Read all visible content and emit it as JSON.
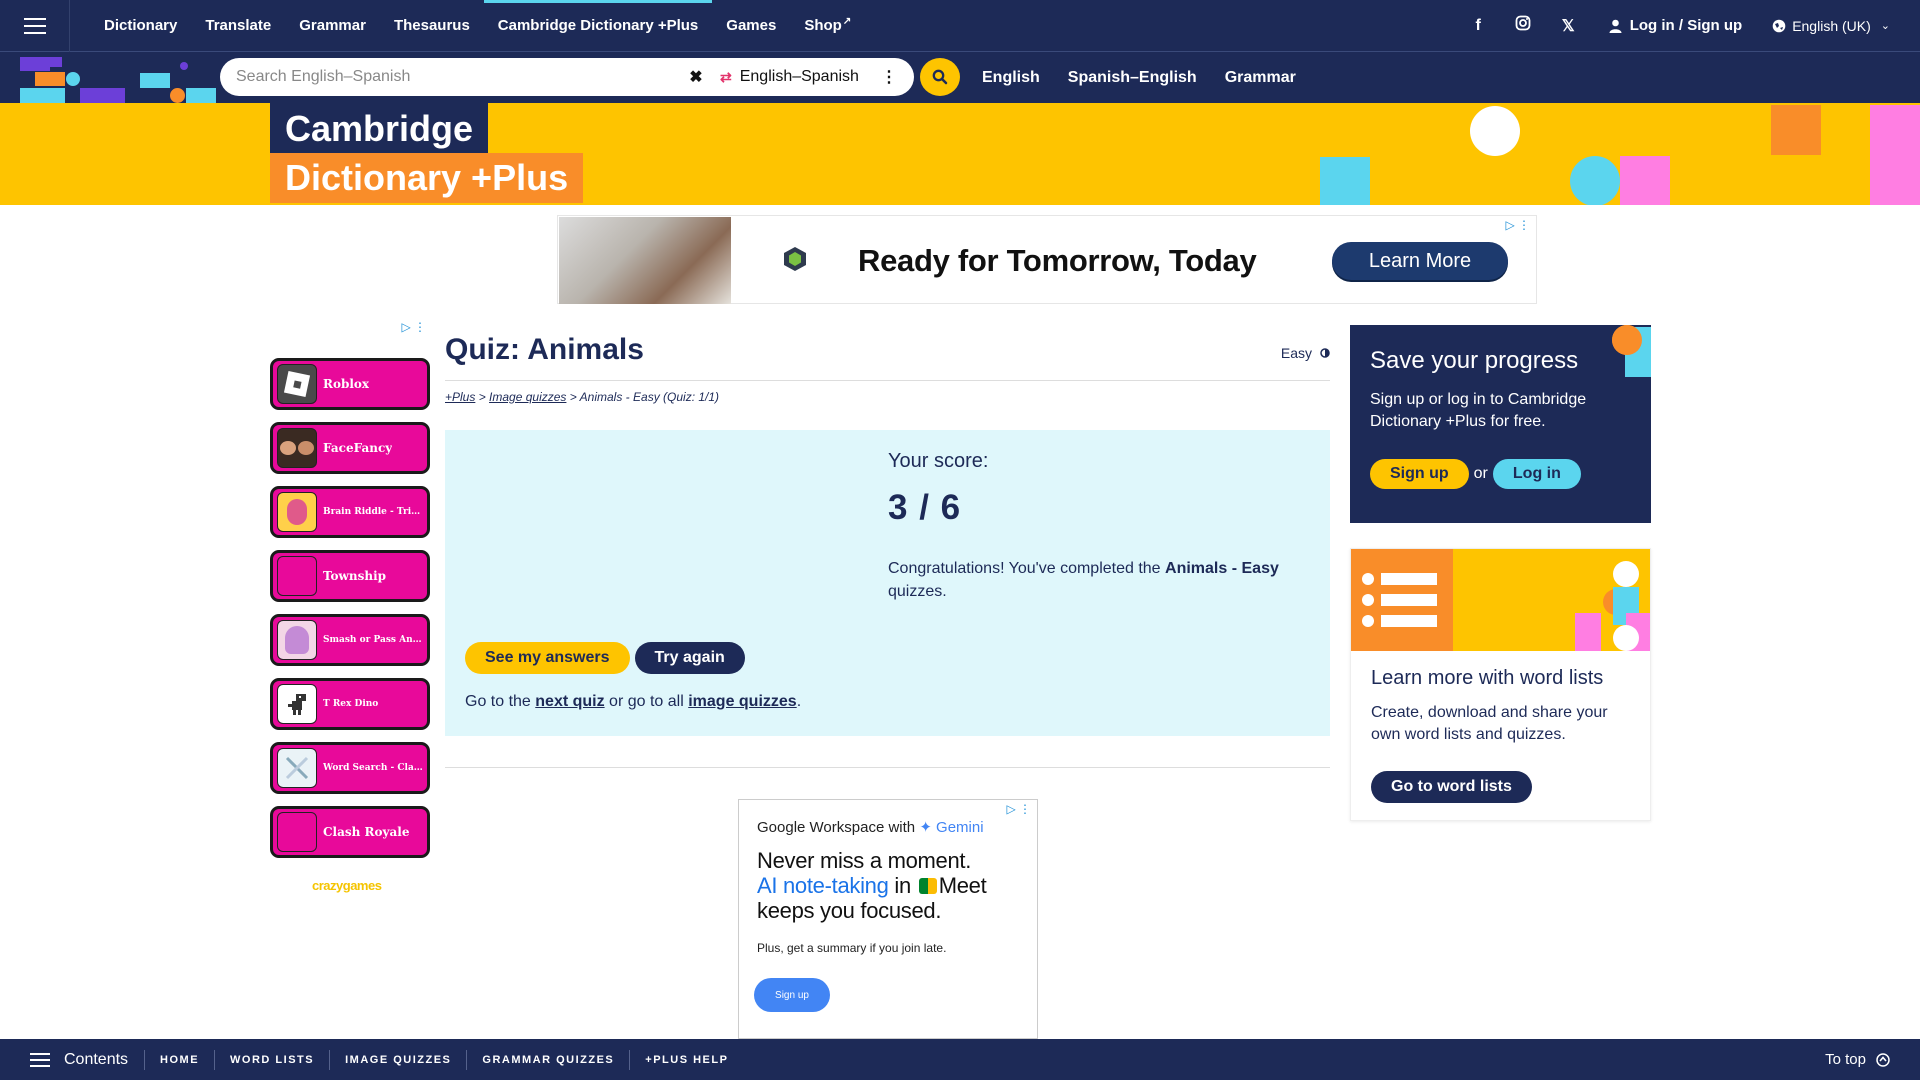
{
  "topnav": {
    "links": [
      "Dictionary",
      "Translate",
      "Grammar",
      "Thesaurus",
      "Cambridge Dictionary +Plus",
      "Games",
      "Shop"
    ],
    "active": "Cambridge Dictionary +Plus",
    "login_label": "Log in / Sign up",
    "language": "English (UK)",
    "social_icons": [
      "facebook-icon",
      "instagram-icon",
      "x-icon"
    ]
  },
  "search": {
    "placeholder": "Search English–Spanish",
    "dictionary": "English–Spanish",
    "sublinks": [
      "English",
      "Spanish–English",
      "Grammar"
    ]
  },
  "banner": {
    "line1": "Cambridge",
    "line2": "Dictionary +Plus"
  },
  "ad_top": {
    "headline": "Ready for Tomorrow, Today",
    "button": "Learn More"
  },
  "left_ad": {
    "games": [
      "Roblox",
      "FaceFancy",
      "Brain Riddle - Tric...",
      "Township",
      "Smash or Pass Ani...",
      "T Rex Dino",
      "Word Search - Clas...",
      "Clash Royale"
    ],
    "brand": "crazygames"
  },
  "quiz": {
    "title": "Quiz: Animals",
    "difficulty": "Easy",
    "breadcrumb": {
      "link1": "+Plus",
      "link2": "Image quizzes",
      "current": "Animals - Easy (Quiz: 1/1)"
    },
    "score_label": "Your score:",
    "score_value": "3 / 6",
    "congrats_prefix": "Congratulations! You've completed the ",
    "congrats_bold": "Animals - Easy",
    "congrats_suffix": " quizzes.",
    "see_answers": "See my answers",
    "try_again": "Try again",
    "goto_prefix": "Go to the ",
    "next_quiz": "next quiz",
    "goto_middle": " or go to all ",
    "image_quizzes": "image quizzes",
    "goto_suffix": "."
  },
  "ad_bottom": {
    "brand_prefix": "Google Workspace with ",
    "brand_gemini": "✦ Gemini",
    "line1": "Never miss a moment.",
    "line2_blue": "AI note-taking",
    "line2_mid": " in ",
    "line2_meet": "Meet",
    "line3": "keeps you focused.",
    "sub": "Plus, get a summary if you join late.",
    "button": "Sign up"
  },
  "save_card": {
    "title": "Save your progress",
    "text": "Sign up or log in to Cambridge Dictionary +Plus for free.",
    "signup": "Sign up",
    "or": "or",
    "login": "Log in"
  },
  "word_card": {
    "title": "Learn more with word lists",
    "text": "Create, download and share your own word lists and quizzes.",
    "button": "Go to word lists"
  },
  "bottombar": {
    "contents": "Contents",
    "links": [
      "HOME",
      "WORD LISTS",
      "IMAGE QUIZZES",
      "GRAMMAR QUIZZES",
      "+PLUS HELP"
    ],
    "to_top": "To top"
  },
  "colors": {
    "navy": "#1d2a57",
    "yellow": "#fec400",
    "orange": "#f98d29",
    "cyan": "#5bd5ee",
    "pink": "#ff7ee2",
    "light_cyan_bg": "#dff7fb",
    "game_magenta": "#e8099a"
  }
}
